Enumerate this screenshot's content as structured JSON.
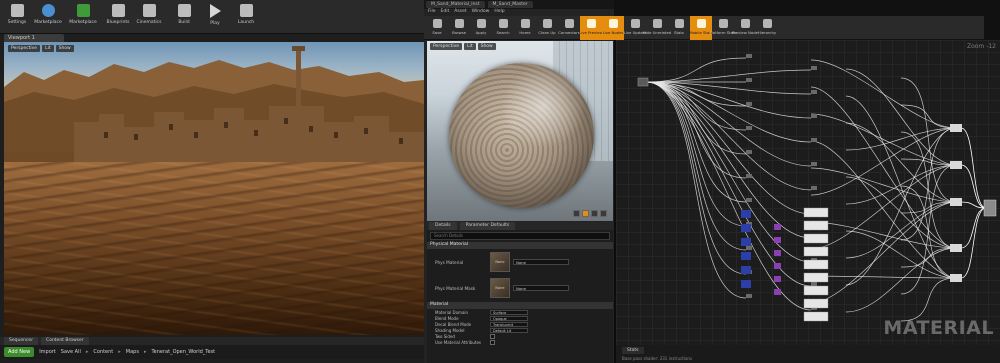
{
  "left_editor": {
    "toolbar": [
      {
        "label": "Settings",
        "icon": "gear-icon"
      },
      {
        "label": "Marketplace",
        "icon": "globe-icon"
      },
      {
        "label": "Marketplace",
        "icon": "marketplace-icon"
      },
      {
        "label": "Blueprints",
        "icon": "blueprint-icon"
      },
      {
        "label": "Cinematics",
        "icon": "clapper-icon"
      },
      {
        "label": "Build",
        "icon": "build-icon"
      },
      {
        "label": "Play",
        "icon": "play-icon"
      },
      {
        "label": "Launch",
        "icon": "launch-icon"
      }
    ],
    "viewport_tab": "Viewport 1",
    "viewport_bar": [
      "Perspective",
      "Lit",
      "Show"
    ],
    "bottom_tabs": [
      "Sequencer",
      "Content Browser"
    ],
    "content_bar": {
      "add_new": "Add New",
      "import": "Import",
      "save_all": "Save All",
      "path": [
        "Content",
        "Maps",
        "Tenerat_Open_World_Test"
      ]
    }
  },
  "material_editor": {
    "title_tabs": [
      "M_Sand_Material_Inst",
      "M_Sand_Master"
    ],
    "menu": [
      "File",
      "Edit",
      "Asset",
      "Window",
      "Help"
    ],
    "toolbar": [
      {
        "label": "Save",
        "active": false
      },
      {
        "label": "Browse",
        "active": false
      },
      {
        "label": "Apply",
        "active": false
      },
      {
        "label": "Search",
        "active": false
      },
      {
        "label": "Home",
        "active": false
      },
      {
        "label": "Clean Up",
        "active": false
      },
      {
        "label": "Connectors",
        "active": false
      },
      {
        "label": "Live Preview",
        "active": true
      },
      {
        "label": "Live Nodes",
        "active": true
      },
      {
        "label": "Live Update",
        "active": false
      },
      {
        "label": "Hide Unrelated",
        "active": false
      },
      {
        "label": "Stats",
        "active": false
      },
      {
        "label": "Mobile Stats",
        "active": true
      },
      {
        "label": "Platform Stats",
        "active": false
      },
      {
        "label": "Preview Node",
        "active": false
      },
      {
        "label": "Hierarchy",
        "active": false
      }
    ],
    "preview_bar": [
      "Perspective",
      "Lit",
      "Show"
    ],
    "details_tabs": [
      "Details",
      "Parameter Defaults"
    ],
    "search_placeholder": "Search Details",
    "physical_material": {
      "category": "Physical Material",
      "rows": [
        {
          "label": "Phys Material",
          "thumb": "None",
          "value": "None"
        },
        {
          "label": "Phys Material Mask",
          "thumb": "None",
          "value": "None"
        }
      ]
    },
    "material": {
      "category": "Material",
      "rows": [
        {
          "label": "Material Domain",
          "value": "Surface"
        },
        {
          "label": "Blend Mode",
          "value": "Opaque"
        },
        {
          "label": "Decal Blend Mode",
          "value": "Translucent"
        },
        {
          "label": "Shading Model",
          "value": "Default Lit"
        },
        {
          "label": "Two Sided",
          "value": ""
        },
        {
          "label": "Use Material Attributes",
          "value": ""
        }
      ]
    }
  },
  "graph": {
    "zoom": "Zoom -12",
    "watermark": "MATERIAL",
    "stats_tab": "Stats",
    "stats_text": "Base pass shader: 231 instructions"
  }
}
